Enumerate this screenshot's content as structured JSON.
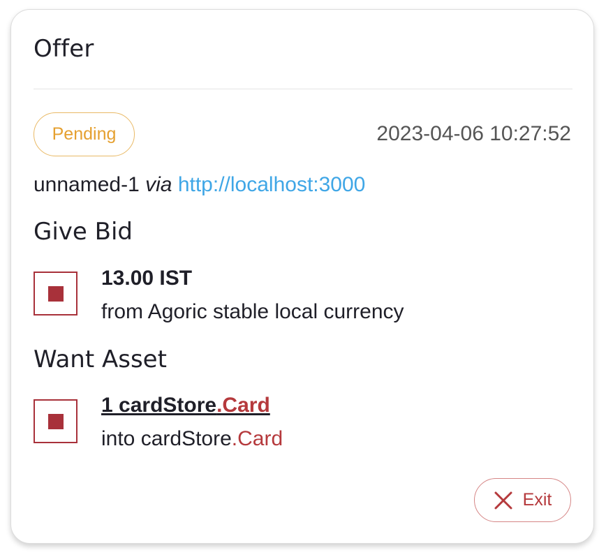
{
  "offer": {
    "title": "Offer",
    "status": "Pending",
    "timestamp": "2023-04-06 10:27:52",
    "dapp_name": "unnamed-1",
    "via_label": "via",
    "origin_url": "http://localhost:3000"
  },
  "give": {
    "heading": "Give Bid",
    "amount": "13.00 IST",
    "description": "from Agoric stable local currency"
  },
  "want": {
    "heading": "Want Asset",
    "amount_prefix": "1 cardStore",
    "amount_suffix": ".Card",
    "description_prefix": "into cardStore",
    "description_suffix": ".Card"
  },
  "actions": {
    "exit_label": "Exit"
  },
  "colors": {
    "accent": "#b5393c",
    "pending": "#e5a030",
    "link": "#3fa6e6"
  },
  "icons": {
    "asset": "asset-square-icon",
    "exit": "close-x-icon"
  }
}
